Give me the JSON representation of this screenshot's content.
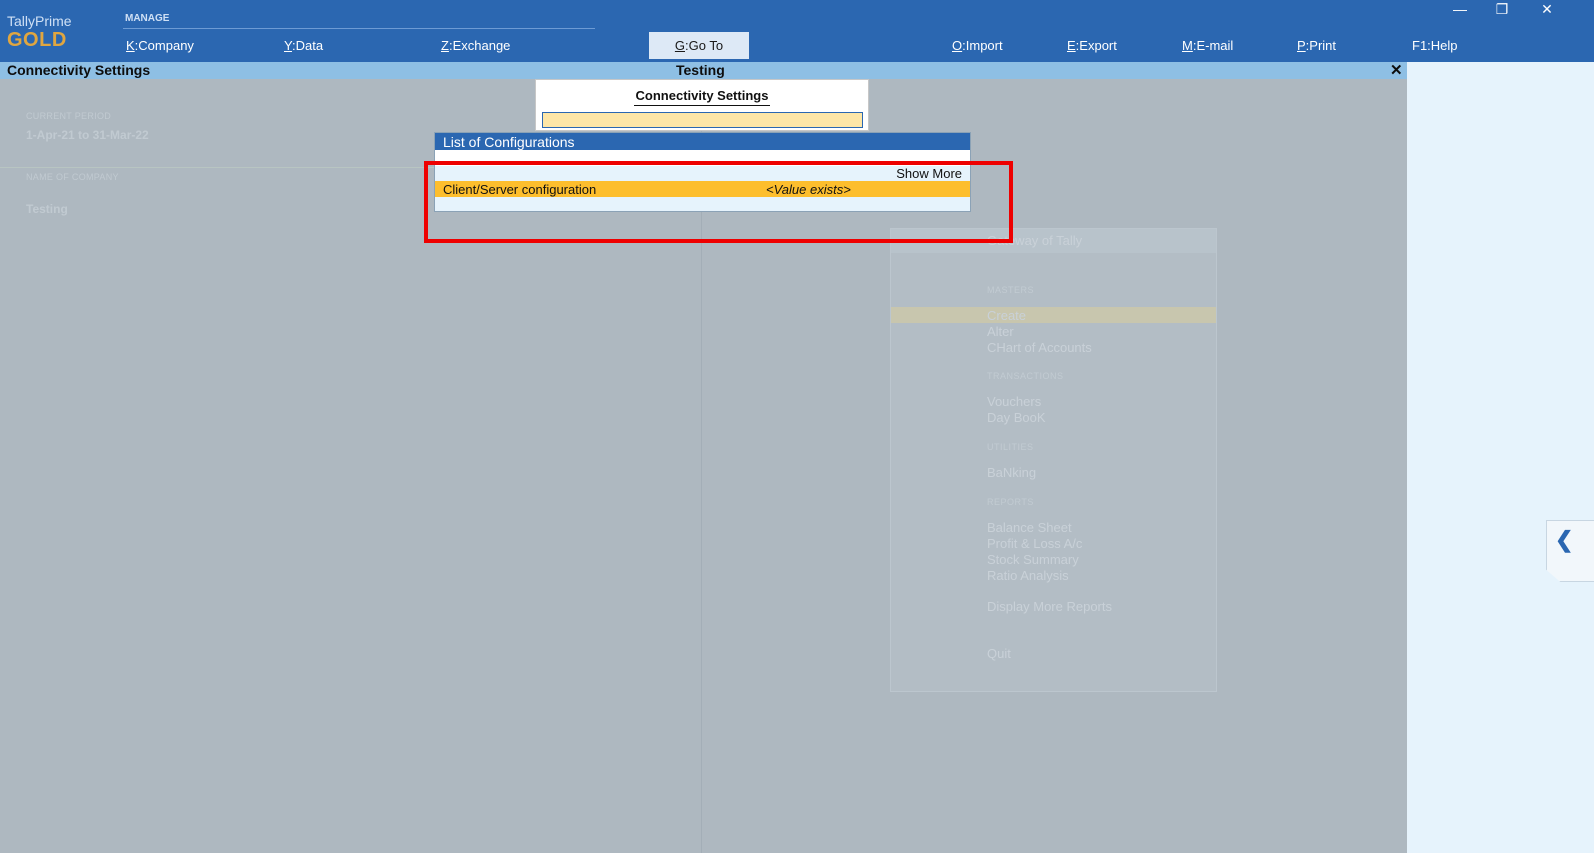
{
  "brand": {
    "name": "TallyPrime",
    "edition": "GOLD"
  },
  "topbar": {
    "manage_label": "MANAGE",
    "menu": [
      {
        "key": "K",
        "label": "Company"
      },
      {
        "key": "Y",
        "label": "Data"
      },
      {
        "key": "Z",
        "label": "Exchange"
      },
      {
        "key": "G",
        "label": "Go To"
      },
      {
        "key": "O",
        "label": "Import"
      },
      {
        "key": "E",
        "label": "Export"
      },
      {
        "key": "M",
        "label": "E-mail"
      },
      {
        "key": "P",
        "label": "Print"
      },
      {
        "key": "F1",
        "label": "Help"
      }
    ],
    "window_controls": {
      "minimize": "—",
      "restore": "❐",
      "close": "✕"
    }
  },
  "titlebar": {
    "left": "Connectivity Settings",
    "center": "Testing",
    "close": "✕"
  },
  "background": {
    "current_period_label": "CURRENT PERIOD",
    "current_period_value": "1-Apr-21 to 31-Mar-22",
    "company_label": "NAME OF COMPANY",
    "company_value": "Testing",
    "gateway": {
      "title": "Gateway of Tally",
      "sections": {
        "masters": "MASTERS",
        "transactions": "TRANSACTIONS",
        "utilities": "UTILITIES",
        "reports": "REPORTS"
      },
      "items": {
        "create": "Create",
        "alter": "Alter",
        "chart": "CHart of Accounts",
        "vouchers": "Vouchers",
        "daybook": "Day BooK",
        "banking": "BaNking",
        "balance": "Balance Sheet",
        "pl": "Profit & Loss A/c",
        "stock": "Stock Summary",
        "ratio": "Ratio Analysis",
        "more": "Display More Reports",
        "quit": "Quit"
      }
    }
  },
  "connectivity_popup": {
    "title": "Connectivity Settings",
    "input_value": ""
  },
  "config_list": {
    "title": "List of Configurations",
    "show_more": "Show More",
    "rows": [
      {
        "name": "Client/Server configuration",
        "value": "<Value exists>"
      }
    ]
  },
  "side_tab": {
    "icon": "chevron-left-icon",
    "glyph": "❮"
  },
  "colors": {
    "topbar": "#2b67b1",
    "titlebar": "#8ebfe4",
    "highlight": "#fdbe2d",
    "annotation": "#ee0000",
    "input": "#fde6a7"
  }
}
